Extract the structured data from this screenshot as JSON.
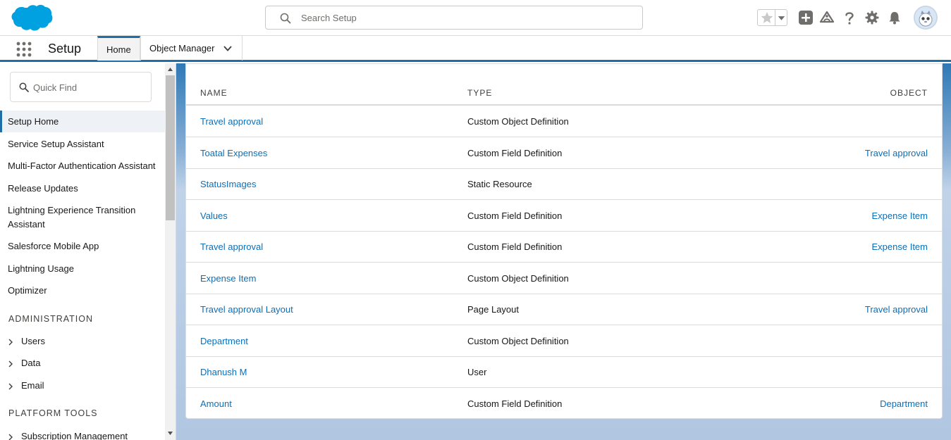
{
  "header": {
    "search_placeholder": "Search Setup"
  },
  "context_bar": {
    "app_name": "Setup",
    "tabs": [
      {
        "label": "Home"
      },
      {
        "label": "Object Manager"
      }
    ]
  },
  "sidebar": {
    "quick_find_placeholder": "Quick Find",
    "items": [
      {
        "label": "Setup Home"
      },
      {
        "label": "Service Setup Assistant"
      },
      {
        "label": "Multi-Factor Authentication Assistant"
      },
      {
        "label": "Release Updates"
      },
      {
        "label": "Lightning Experience Transition Assistant"
      },
      {
        "label": "Salesforce Mobile App"
      },
      {
        "label": "Lightning Usage"
      },
      {
        "label": "Optimizer"
      }
    ],
    "sections": [
      {
        "title": "ADMINISTRATION",
        "items": [
          {
            "label": "Users"
          },
          {
            "label": "Data"
          },
          {
            "label": "Email"
          }
        ]
      },
      {
        "title": "PLATFORM TOOLS",
        "items": [
          {
            "label": "Subscription Management"
          }
        ]
      }
    ]
  },
  "table": {
    "columns": {
      "name": "NAME",
      "type": "TYPE",
      "object": "OBJECT"
    },
    "rows": [
      {
        "name": "Travel approval",
        "type": "Custom Object Definition",
        "object": ""
      },
      {
        "name": "Toatal Expenses",
        "type": "Custom Field Definition",
        "object": "Travel approval"
      },
      {
        "name": "StatusImages",
        "type": "Static Resource",
        "object": ""
      },
      {
        "name": "Values",
        "type": "Custom Field Definition",
        "object": "Expense Item"
      },
      {
        "name": "Travel approval",
        "type": "Custom Field Definition",
        "object": "Expense Item"
      },
      {
        "name": "Expense Item",
        "type": "Custom Object Definition",
        "object": ""
      },
      {
        "name": "Travel approval Layout",
        "type": "Page Layout",
        "object": "Travel approval"
      },
      {
        "name": "Department",
        "type": "Custom Object Definition",
        "object": ""
      },
      {
        "name": "Dhanush M",
        "type": "User",
        "object": ""
      },
      {
        "name": "Amount",
        "type": "Custom Field Definition",
        "object": "Department"
      }
    ]
  },
  "icons": {
    "logo": "salesforce-cloud-logo",
    "search": "search-icon",
    "favorites": "star-icon",
    "global_actions": "plus-icon",
    "trailhead": "trailhead-icon",
    "help": "question-icon",
    "setup": "gear-icon",
    "notifications": "bell-icon",
    "avatar": "user-avatar"
  },
  "colors": {
    "brand": "#1f6ea8",
    "link": "#0b6fb9",
    "logo": "#00a1e0"
  }
}
